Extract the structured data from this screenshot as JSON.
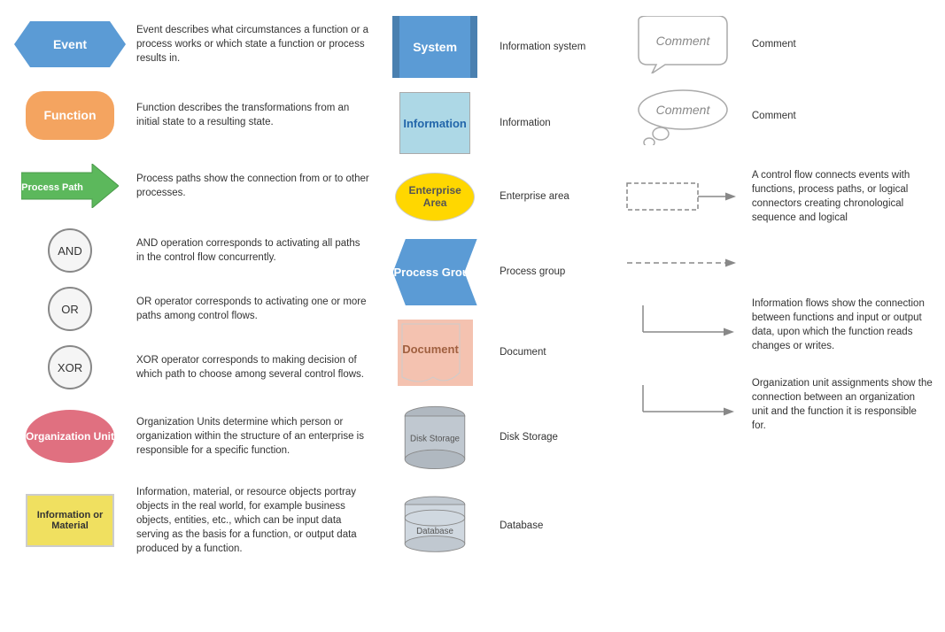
{
  "items": {
    "event": {
      "label": "Event",
      "desc": "Event describes what circumstances a function or a process works or which state a function or process results in."
    },
    "function": {
      "label": "Function",
      "desc": "Function describes the transformations from an initial state to a resulting state."
    },
    "process_path": {
      "label": "Process Path",
      "desc": "Process paths show the connection from or to other processes."
    },
    "and": {
      "label": "AND",
      "desc": "AND operation corresponds to activating all paths in the control flow concurrently."
    },
    "or": {
      "label": "OR",
      "desc": "OR operator corresponds to activating one or more paths among control flows."
    },
    "xor": {
      "label": "XOR",
      "desc": "XOR operator corresponds to making decision of which path to choose among several control flows."
    },
    "org_unit": {
      "label": "Organization Unit",
      "desc": "Organization Units determine which person or organization within the structure of an enterprise is responsible for a specific function."
    },
    "info_material": {
      "label": "Information or Material",
      "desc": "Information, material, or resource objects portray objects in the real world, for example business objects, entities, etc., which can be input data serving as the basis for a function, or output data produced by a function."
    },
    "system": {
      "label": "System",
      "desc": "Information system"
    },
    "information": {
      "label": "Information",
      "desc": "Information"
    },
    "enterprise_area": {
      "label": "Enterprise Area",
      "desc": "Enterprise area"
    },
    "process_group": {
      "label": "Process Group",
      "desc": "Process group"
    },
    "document": {
      "label": "Document",
      "desc": "Document"
    },
    "disk_storage": {
      "label": "Disk Storage",
      "desc": "Disk Storage"
    },
    "database": {
      "label": "Database",
      "desc": "Database"
    },
    "comment1": {
      "label": "Comment",
      "text": "Comment",
      "desc": "Comment"
    },
    "comment2": {
      "label": "Comment",
      "text": "Comment",
      "desc": "Comment"
    },
    "control_flow": {
      "desc": "A control flow connects events with functions, process paths, or logical connectors creating chronological sequence and logical"
    },
    "dashed_flow": {
      "desc": ""
    },
    "info_flow": {
      "desc": "Information flows show the connection between functions and input or output data, upon which the function reads changes or writes."
    },
    "org_assign": {
      "desc": "Organization unit assignments show the connection between an organization unit and the function it is responsible for."
    }
  }
}
